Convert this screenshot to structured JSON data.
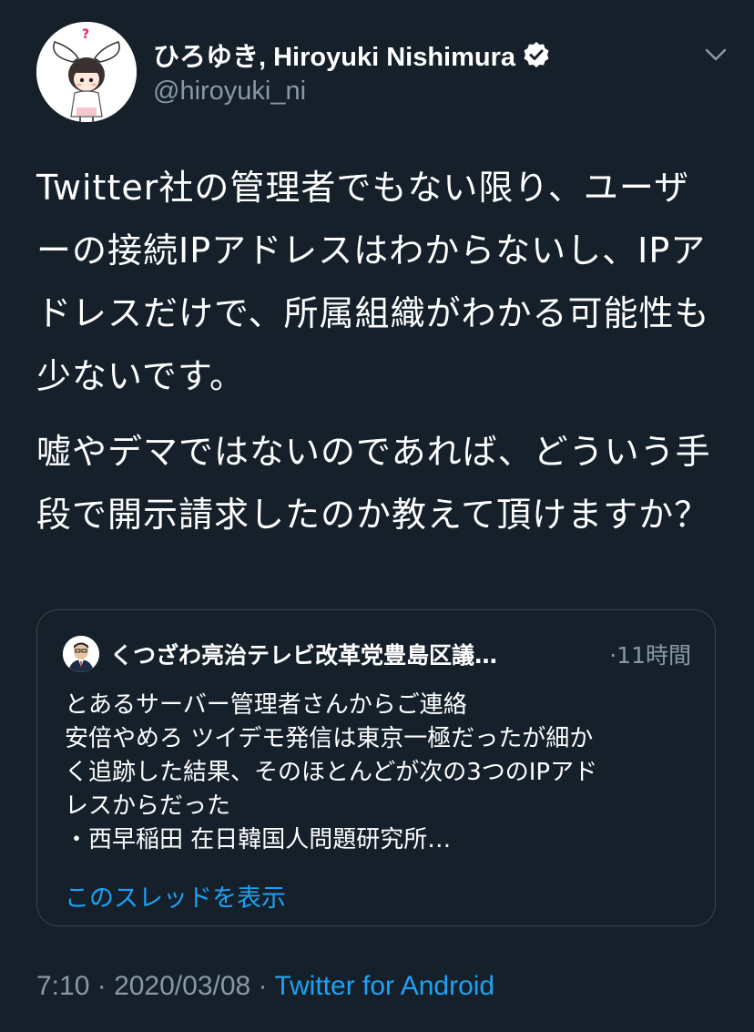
{
  "author": {
    "display_name": "ひろゆき, Hiroyuki Nishimura",
    "handle": "@hiroyuki_ni",
    "avatar_icon": "anime-girl-bunny-ears-avatar",
    "verified_icon": "verified-badge-icon"
  },
  "menu_icon": "chevron-down-icon",
  "tweet": {
    "paragraphs": [
      "Twitter社の管理者でもない限り、ユーザーの接続IPアドレスはわからないし、IPアドレスだけで、所属組織がわかる可能性も少ないです。",
      "嘘やデマではないのであれば、どういう手段で開示請求したのか教えて頂けますか？"
    ]
  },
  "quoted_tweet": {
    "author_name": "くつざわ亮治テレビ改革党豊島区議…",
    "time": "·11時間",
    "avatar_icon": "man-in-suit-avatar",
    "lines": [
      "とあるサーバー管理者さんからご連絡",
      "安倍やめろ ツイデモ発信は東京一極だったが細か",
      "く追跡した結果、そのほとんどが次の3つのIPアド",
      "レスからだった",
      "・西早稲田 在日韓国人問題研究所…"
    ],
    "thread_link": "このスレッドを表示"
  },
  "meta": {
    "time": "7:10",
    "separator1": " · ",
    "date": "2020/03/08",
    "separator2": " · ",
    "source": "Twitter for Android"
  },
  "colors": {
    "background": "#15202b",
    "text": "#ffffff",
    "secondary": "#8899a6",
    "accent": "#1da1f2",
    "border": "#38444d"
  }
}
